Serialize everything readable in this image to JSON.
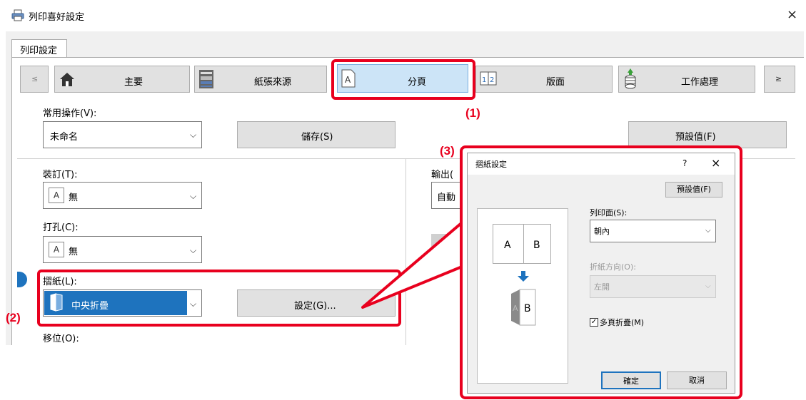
{
  "window": {
    "title": "列印喜好設定",
    "close_label": "×"
  },
  "tab": {
    "label": "列印設定"
  },
  "nav": {
    "prev_label": "≤",
    "next_label": "≥",
    "items": [
      {
        "label": "主要",
        "icon": "home-icon"
      },
      {
        "label": "紙張來源",
        "icon": "printer-tray-icon"
      },
      {
        "label": "分頁",
        "icon": "page-a-icon"
      },
      {
        "label": "版面",
        "icon": "layout-12-icon"
      },
      {
        "label": "工作處理",
        "icon": "stack-disk-icon"
      }
    ]
  },
  "common": {
    "label": "常用操作(V):",
    "value": "未命名",
    "save_label": "儲存(S)",
    "default_label": "預設值(F)"
  },
  "binding": {
    "label": "裝訂(T):",
    "value": "無",
    "icon_letter": "A"
  },
  "punch": {
    "label": "打孔(C):",
    "value": "無",
    "icon_letter": "A"
  },
  "fold": {
    "label": "摺紙(L):",
    "value": "中央折疊",
    "settings_label": "設定(G)..."
  },
  "shift": {
    "label": "移位(O):"
  },
  "output": {
    "label": "輸出(",
    "value": "自動"
  },
  "annotations": {
    "a1": "(1)",
    "a2": "(2)",
    "a3": "(3)"
  },
  "dialog": {
    "title": "摺紙設定",
    "help": "?",
    "close": "×",
    "default_label": "預設值(F)",
    "print_side_label": "列印面(S):",
    "print_side_value": "朝內",
    "fold_dir_label": "折紙方向(O):",
    "fold_dir_value": "左開",
    "multi_page_label": "多頁折疊(M)",
    "multi_page_checked": true,
    "ok_label": "確定",
    "cancel_label": "取消",
    "preview": {
      "letter_a": "A",
      "letter_b": "B"
    }
  },
  "colors": {
    "accent_red": "#e8001e",
    "selected_blue": "#1e73be",
    "tab_selected_bg": "#cce4f7"
  }
}
